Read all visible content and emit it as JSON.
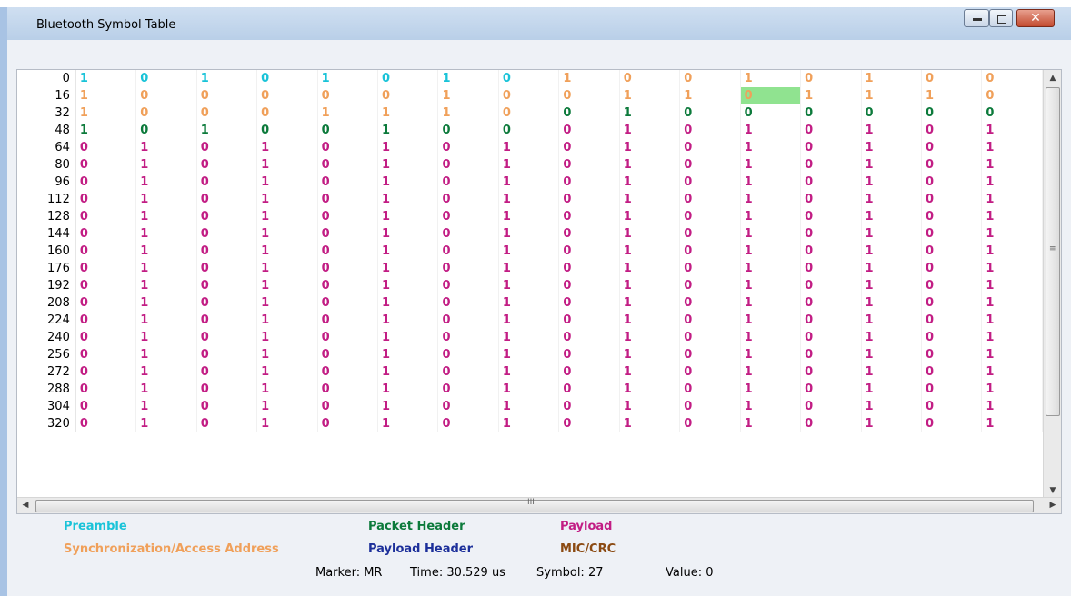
{
  "window": {
    "title": "Bluetooth Symbol Table",
    "min_icon": "minimize-icon",
    "max_icon": "maximize-icon",
    "close_icon": "close-icon",
    "close_glyph": "✕"
  },
  "table": {
    "row_indices": [
      "0",
      "16",
      "32",
      "48",
      "64",
      "80",
      "96",
      "112",
      "128",
      "144",
      "160",
      "176",
      "192",
      "208",
      "224",
      "240",
      "256",
      "272",
      "288",
      "304",
      "320"
    ],
    "rows": [
      [
        "1",
        "0",
        "1",
        "0",
        "1",
        "0",
        "1",
        "0",
        "1",
        "0",
        "0",
        "1",
        "0",
        "1",
        "0",
        "0"
      ],
      [
        "1",
        "0",
        "0",
        "0",
        "0",
        "0",
        "1",
        "0",
        "0",
        "1",
        "1",
        "0",
        "1",
        "1",
        "1",
        "0"
      ],
      [
        "1",
        "0",
        "0",
        "0",
        "1",
        "1",
        "1",
        "0",
        "0",
        "1",
        "0",
        "0",
        "0",
        "0",
        "0",
        "0"
      ],
      [
        "1",
        "0",
        "1",
        "0",
        "0",
        "1",
        "0",
        "0",
        "0",
        "1",
        "0",
        "1",
        "0",
        "1",
        "0",
        "1"
      ],
      [
        "0",
        "1",
        "0",
        "1",
        "0",
        "1",
        "0",
        "1",
        "0",
        "1",
        "0",
        "1",
        "0",
        "1",
        "0",
        "1"
      ],
      [
        "0",
        "1",
        "0",
        "1",
        "0",
        "1",
        "0",
        "1",
        "0",
        "1",
        "0",
        "1",
        "0",
        "1",
        "0",
        "1"
      ],
      [
        "0",
        "1",
        "0",
        "1",
        "0",
        "1",
        "0",
        "1",
        "0",
        "1",
        "0",
        "1",
        "0",
        "1",
        "0",
        "1"
      ],
      [
        "0",
        "1",
        "0",
        "1",
        "0",
        "1",
        "0",
        "1",
        "0",
        "1",
        "0",
        "1",
        "0",
        "1",
        "0",
        "1"
      ],
      [
        "0",
        "1",
        "0",
        "1",
        "0",
        "1",
        "0",
        "1",
        "0",
        "1",
        "0",
        "1",
        "0",
        "1",
        "0",
        "1"
      ],
      [
        "0",
        "1",
        "0",
        "1",
        "0",
        "1",
        "0",
        "1",
        "0",
        "1",
        "0",
        "1",
        "0",
        "1",
        "0",
        "1"
      ],
      [
        "0",
        "1",
        "0",
        "1",
        "0",
        "1",
        "0",
        "1",
        "0",
        "1",
        "0",
        "1",
        "0",
        "1",
        "0",
        "1"
      ],
      [
        "0",
        "1",
        "0",
        "1",
        "0",
        "1",
        "0",
        "1",
        "0",
        "1",
        "0",
        "1",
        "0",
        "1",
        "0",
        "1"
      ],
      [
        "0",
        "1",
        "0",
        "1",
        "0",
        "1",
        "0",
        "1",
        "0",
        "1",
        "0",
        "1",
        "0",
        "1",
        "0",
        "1"
      ],
      [
        "0",
        "1",
        "0",
        "1",
        "0",
        "1",
        "0",
        "1",
        "0",
        "1",
        "0",
        "1",
        "0",
        "1",
        "0",
        "1"
      ],
      [
        "0",
        "1",
        "0",
        "1",
        "0",
        "1",
        "0",
        "1",
        "0",
        "1",
        "0",
        "1",
        "0",
        "1",
        "0",
        "1"
      ],
      [
        "0",
        "1",
        "0",
        "1",
        "0",
        "1",
        "0",
        "1",
        "0",
        "1",
        "0",
        "1",
        "0",
        "1",
        "0",
        "1"
      ],
      [
        "0",
        "1",
        "0",
        "1",
        "0",
        "1",
        "0",
        "1",
        "0",
        "1",
        "0",
        "1",
        "0",
        "1",
        "0",
        "1"
      ],
      [
        "0",
        "1",
        "0",
        "1",
        "0",
        "1",
        "0",
        "1",
        "0",
        "1",
        "0",
        "1",
        "0",
        "1",
        "0",
        "1"
      ],
      [
        "0",
        "1",
        "0",
        "1",
        "0",
        "1",
        "0",
        "1",
        "0",
        "1",
        "0",
        "1",
        "0",
        "1",
        "0",
        "1"
      ],
      [
        "0",
        "1",
        "0",
        "1",
        "0",
        "1",
        "0",
        "1",
        "0",
        "1",
        "0",
        "1",
        "0",
        "1",
        "0",
        "1"
      ],
      [
        "0",
        "1",
        "0",
        "1",
        "0",
        "1",
        "0",
        "1",
        "0",
        "1",
        "0",
        "1",
        "0",
        "1",
        "0",
        "1"
      ]
    ],
    "row_categories": [
      [
        "preamble",
        "preamble",
        "preamble",
        "preamble",
        "preamble",
        "preamble",
        "preamble",
        "preamble",
        "sync",
        "sync",
        "sync",
        "sync",
        "sync",
        "sync",
        "sync",
        "sync"
      ],
      [
        "sync",
        "sync",
        "sync",
        "sync",
        "sync",
        "sync",
        "sync",
        "sync",
        "sync",
        "sync",
        "sync",
        "sync",
        "sync",
        "sync",
        "sync",
        "sync"
      ],
      [
        "sync",
        "sync",
        "sync",
        "sync",
        "sync",
        "sync",
        "sync",
        "sync",
        "pkthdr",
        "pkthdr",
        "pkthdr",
        "pkthdr",
        "pkthdr",
        "pkthdr",
        "pkthdr",
        "pkthdr"
      ],
      [
        "pkthdr",
        "pkthdr",
        "pkthdr",
        "pkthdr",
        "pkthdr",
        "pkthdr",
        "pkthdr",
        "pkthdr",
        "payload",
        "payload",
        "payload",
        "payload",
        "payload",
        "payload",
        "payload",
        "payload"
      ],
      [
        "payload"
      ],
      [
        "payload"
      ],
      [
        "payload"
      ],
      [
        "payload"
      ],
      [
        "payload"
      ],
      [
        "payload"
      ],
      [
        "payload"
      ],
      [
        "payload"
      ],
      [
        "payload"
      ],
      [
        "payload"
      ],
      [
        "payload"
      ],
      [
        "payload"
      ],
      [
        "payload"
      ],
      [
        "payload"
      ],
      [
        "payload"
      ],
      [
        "payload"
      ],
      [
        "payload"
      ]
    ],
    "selected_symbol": 27,
    "scroll_grip_vertical": "≡",
    "scroll_grip_horizontal": "III",
    "arrow_up": "▲",
    "arrow_down": "▼",
    "arrow_left": "◀",
    "arrow_right": "▶"
  },
  "legend": {
    "preamble": "Preamble",
    "sync": "Synchronization/Access Address",
    "packet_header": "Packet Header",
    "payload_header": "Payload Header",
    "payload": "Payload",
    "mic_crc": "MIC/CRC"
  },
  "colors": {
    "preamble": "#19c3d8",
    "sync": "#f0a05a",
    "packet_header": "#0c7a3b",
    "payload_header": "#1c2f9a",
    "payload": "#c21d84",
    "mic_crc": "#8b4a12",
    "highlight": "#90e390"
  },
  "status": {
    "marker": "Marker:  MR",
    "time": "Time: 30.529 us",
    "symbol": "Symbol:  27",
    "value": "Value:  0"
  }
}
